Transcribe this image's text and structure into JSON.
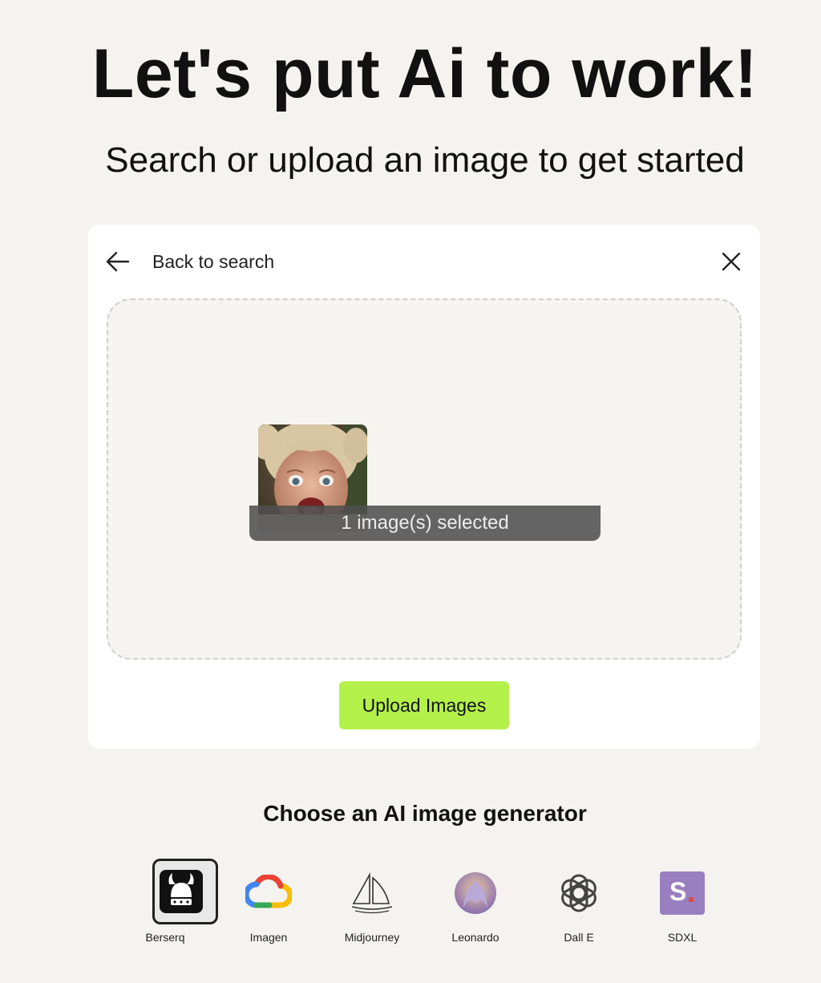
{
  "hero": {
    "title": "Let's put Ai to work!",
    "subtitle": "Search or upload an image to get started"
  },
  "card": {
    "back_label": "Back to search",
    "selection_text": "1 image(s) selected",
    "upload_label": "Upload Images"
  },
  "generators": {
    "heading": "Choose an AI image generator",
    "items": [
      {
        "name": "Berserq",
        "icon": "berserq-logo-icon",
        "selected": true
      },
      {
        "name": "Imagen",
        "icon": "google-cloud-icon",
        "selected": false
      },
      {
        "name": "Midjourney",
        "icon": "midjourney-sailboat-icon",
        "selected": false
      },
      {
        "name": "Leonardo",
        "icon": "leonardo-avatar-icon",
        "selected": false
      },
      {
        "name": "Dall E",
        "icon": "openai-knot-icon",
        "selected": false
      },
      {
        "name": "SDXL",
        "icon": "sdxl-s-icon",
        "selected": false
      }
    ],
    "sdxl_logo_text": "S"
  },
  "colors": {
    "background": "#f4f3ef",
    "card": "#ffffff",
    "accent_button": "#b3f04a",
    "sdxl_purple": "#9a7fc0"
  }
}
